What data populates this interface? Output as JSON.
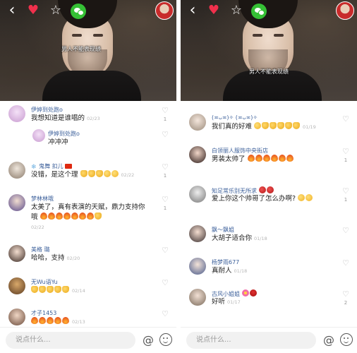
{
  "left": {
    "caption": "男人不能表现绩",
    "input_placeholder": "说点什么...",
    "comments": [
      {
        "name": "伊婷到处跑o",
        "text": "我想知道是谁唱的",
        "time": "02/23",
        "likes": "1"
      },
      {
        "name": "伊婷到处跑o",
        "text": "冲冲冲",
        "time": "",
        "likes": ""
      },
      {
        "name": "鬼舞 扣儿",
        "text": "没错，是这个理",
        "time": "02/22",
        "likes": "1"
      },
      {
        "name": "梦林林哦",
        "text": "太美了，真有表演的天赋，鼎力支持你哦",
        "time": "02/22",
        "likes": "1"
      },
      {
        "name": "美格 璐",
        "text": "哈哈，支持",
        "time": "02/20",
        "likes": ""
      },
      {
        "name": "无Wu语Yu",
        "text": "",
        "time": "02/14",
        "likes": ""
      },
      {
        "name": "才子1453",
        "text": "",
        "time": "02/13",
        "likes": ""
      }
    ]
  },
  "right": {
    "caption": "男人不能表现绩",
    "input_placeholder": "说点什么...",
    "comments": [
      {
        "name": "(≖ᴗ≖)✧ (≖ᴗ≖)✧",
        "text": "我们真的好难",
        "time": "01/19",
        "likes": ""
      },
      {
        "name": "白领丽人服饰中央街店",
        "text": "男装太帅了",
        "time": "",
        "likes": "1"
      },
      {
        "name": "知足常乐别无所求",
        "text": "爱上你这个帅哥了怎么办啊?",
        "time": "",
        "likes": "1"
      },
      {
        "name": "飘～飘姐",
        "text": "大胡子适合你",
        "time": "01/18",
        "likes": ""
      },
      {
        "name": "杨梦雨677",
        "text": "真耐人",
        "time": "01/18",
        "likes": ""
      },
      {
        "name": "古风小姐姐",
        "text": "好听",
        "time": "01/17",
        "likes": "2"
      }
    ]
  },
  "icons": [
    "back-icon",
    "heart-icon",
    "star-icon",
    "wechat-icon",
    "like-icon",
    "at-icon",
    "emoji-icon"
  ]
}
